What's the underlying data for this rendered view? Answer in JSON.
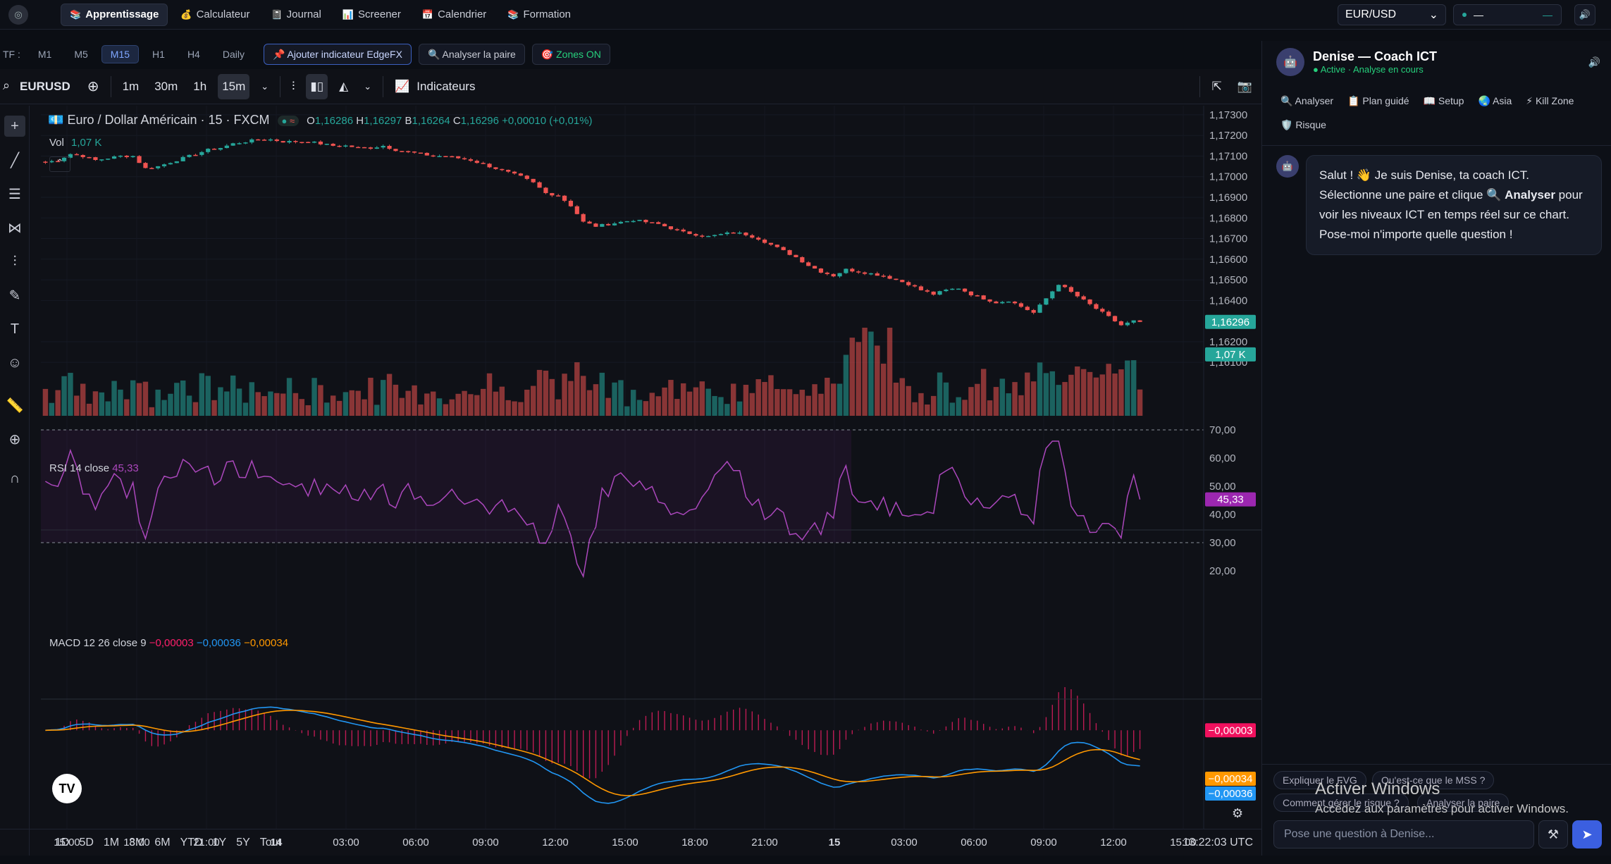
{
  "nav": {
    "items": [
      {
        "icon": "📚",
        "label": "Apprentissage",
        "active": true
      },
      {
        "icon": "💰",
        "label": "Calculateur"
      },
      {
        "icon": "📓",
        "label": "Journal"
      },
      {
        "icon": "📊",
        "label": "Screener"
      },
      {
        "icon": "📅",
        "label": "Calendrier"
      },
      {
        "icon": "📚",
        "label": "Formation"
      }
    ],
    "pair": "EUR/USD",
    "price": "—",
    "price2": "—"
  },
  "tfbar": {
    "label": "TF :",
    "timeframes": [
      "M1",
      "M5",
      "M15",
      "H1",
      "H4",
      "Daily"
    ],
    "active_tf": "M15",
    "add_indicator": "📌 Ajouter indicateur EdgeFX",
    "analyze": "🔍 Analyser la paire",
    "zones": "🎯 Zones ON"
  },
  "chart_toolbar": {
    "symbol": "EURUSD",
    "intervals": [
      "1m",
      "30m",
      "1h",
      "15m"
    ],
    "active_interval": "15m",
    "indicators": "Indicateurs"
  },
  "legend": {
    "title": "Euro / Dollar Américain · 15 · FXCM",
    "o": "1,16286",
    "h": "1,16297",
    "b": "1,16264",
    "c": "1,16296",
    "change": "+0,00010 (+0,01%)",
    "vol_label": "Vol",
    "vol_value": "1,07 K"
  },
  "rsi": {
    "label": "RSI 14 close",
    "value": "45,33"
  },
  "macd": {
    "label": "MACD 12 26 close 9",
    "v1": "−0,00003",
    "v2": "−0,00036",
    "v3": "−0,00034"
  },
  "price_axis": [
    "1,17300",
    "1,17200",
    "1,17100",
    "1,17000",
    "1,16900",
    "1,16800",
    "1,16700",
    "1,16600",
    "1,16500",
    "1,16400",
    "1,16200",
    "1,16100"
  ],
  "price_tag": "1,16296",
  "vol_tag": "1,07 K",
  "rsi_axis": [
    "70,00",
    "60,00",
    "50,00",
    "40,00",
    "30,00",
    "20,00"
  ],
  "rsi_tag": "45,33",
  "macd_tags": [
    "−0,00003",
    "−0,00034",
    "−0,00036"
  ],
  "time_axis": [
    "15:00",
    "18:00",
    "21:00",
    "14",
    "03:00",
    "06:00",
    "09:00",
    "12:00",
    "15:00",
    "18:00",
    "21:00",
    "15",
    "03:00",
    "06:00",
    "09:00",
    "12:00",
    "15:00"
  ],
  "ranges": [
    "1D",
    "5D",
    "1M",
    "3M",
    "6M",
    "YTD",
    "1Y",
    "5Y",
    "Tout"
  ],
  "clock": "13:22:03 UTC",
  "colors": {
    "up": "#26a69a",
    "down": "#ef5350",
    "rsi": "#9c27b0",
    "macd": "#2196f3",
    "signal": "#ff9800",
    "hist": "#e91e63"
  },
  "chart_data": [
    {
      "type": "candlestick",
      "title": "Euro / Dollar Américain · 15 · FXCM",
      "close_path": [
        1.1707,
        1.1708,
        1.1711,
        1.171,
        1.1708,
        1.1709,
        1.171,
        1.171,
        1.1704,
        1.1705,
        1.1707,
        1.1709,
        1.1711,
        1.1713,
        1.1714,
        1.1716,
        1.1717,
        1.1718,
        1.1718,
        1.1717,
        1.1717,
        1.1717,
        1.1716,
        1.1715,
        1.1715,
        1.1714,
        1.1714,
        1.1715,
        1.1713,
        1.1712,
        1.1711,
        1.171,
        1.171,
        1.1709,
        1.1708,
        1.1706,
        1.1704,
        1.1702,
        1.17,
        1.1697,
        1.1692,
        1.1691,
        1.1686,
        1.1678,
        1.1676,
        1.1677,
        1.1678,
        1.1679,
        1.1678,
        1.1677,
        1.1675,
        1.1673,
        1.1672,
        1.1671,
        1.1672,
        1.1673,
        1.1672,
        1.167,
        1.1667,
        1.1664,
        1.1661,
        1.1657,
        1.1654,
        1.1652,
        1.1655,
        1.1654,
        1.1653,
        1.1652,
        1.165,
        1.1648,
        1.1645,
        1.1643,
        1.1645,
        1.1646,
        1.1643,
        1.1641,
        1.1639,
        1.164,
        1.1637,
        1.1634,
        1.1641,
        1.1648,
        1.1644,
        1.164,
        1.1636,
        1.1632,
        1.1628,
        1.163
      ],
      "price_range": [
        1.1608,
        1.1731
      ]
    },
    {
      "type": "bar",
      "title": "Vol",
      "last": "1,07 K"
    },
    {
      "type": "line",
      "title": "RSI 14 close",
      "last": 45.33,
      "ylim": [
        15,
        73
      ],
      "bands": [
        30,
        70
      ]
    },
    {
      "type": "line",
      "title": "MACD 12 26 close 9",
      "macd_last": -0.00036,
      "signal_last": -0.00034,
      "hist_last": -3e-05
    }
  ],
  "panel": {
    "name": "Denise — Coach ICT",
    "status": "Active · Analyse en cours",
    "quick": [
      "🔍 Analyser",
      "📋 Plan guidé",
      "📖 Setup",
      "🌏 Asia",
      "⚡ Kill Zone",
      "🛡️ Risque"
    ],
    "message": {
      "p1": "Salut ! 👋 Je suis Denise, ta coach ICT. Sélectionne une paire et clique 🔍 ",
      "bold": "Analyser",
      "p2": " pour voir les niveaux ICT en temps réel sur ce chart. Pose-moi n'importe quelle question !"
    },
    "suggestions": [
      "Expliquer le FVG",
      "Qu'est-ce que le MSS ?",
      "Comment gérer le risque ?",
      "Analyser la paire"
    ],
    "input_placeholder": "Pose une question à Denise..."
  },
  "windows": {
    "line1": "Activer Windows",
    "line2": "Accédez aux paramètres pour activer Windows."
  }
}
